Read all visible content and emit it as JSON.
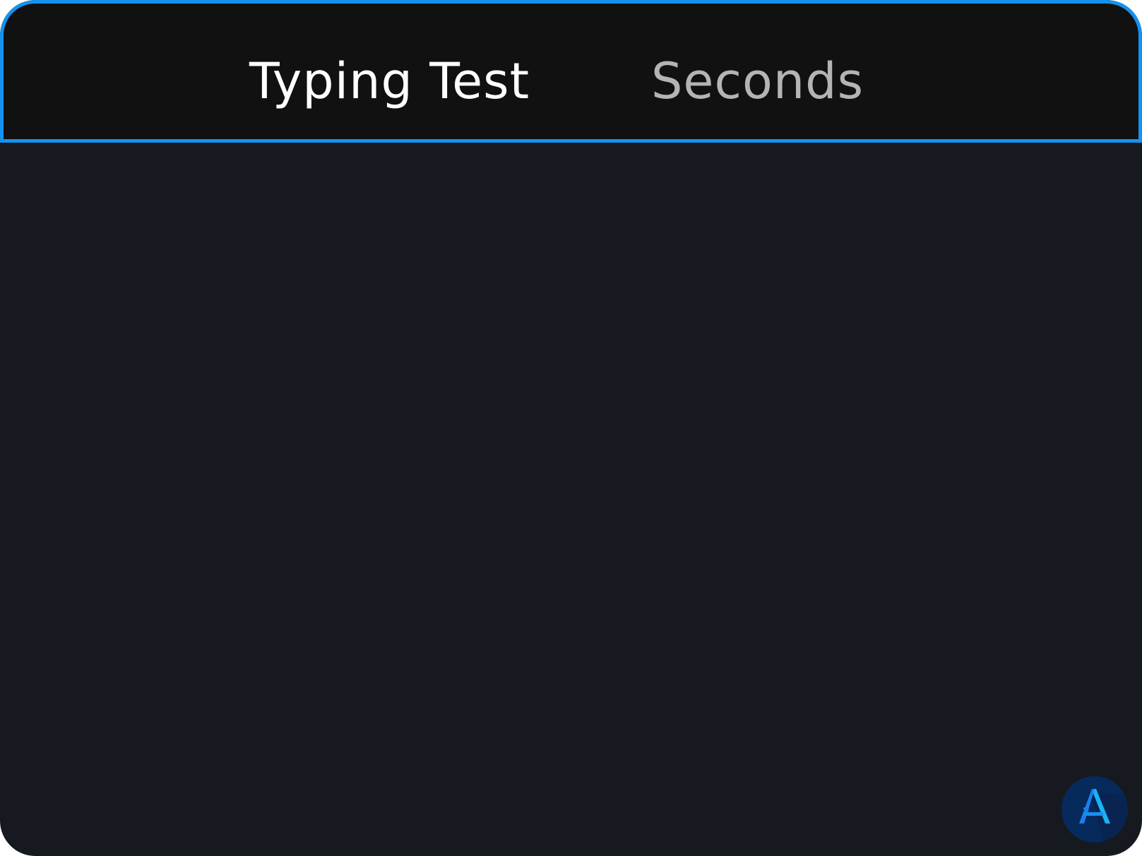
{
  "header": {
    "title": "Typing Test",
    "timer_label": "Seconds"
  },
  "logo": {
    "icon": "a-logo-icon",
    "letter": "A"
  },
  "colors": {
    "background": "#161920",
    "header_background": "#111111",
    "accent_border": "#1592f0",
    "title_text": "#ffffff",
    "timer_text": "#b4b4b4",
    "logo_background": "#072a5c",
    "logo_letter": "#1a8cf5"
  }
}
